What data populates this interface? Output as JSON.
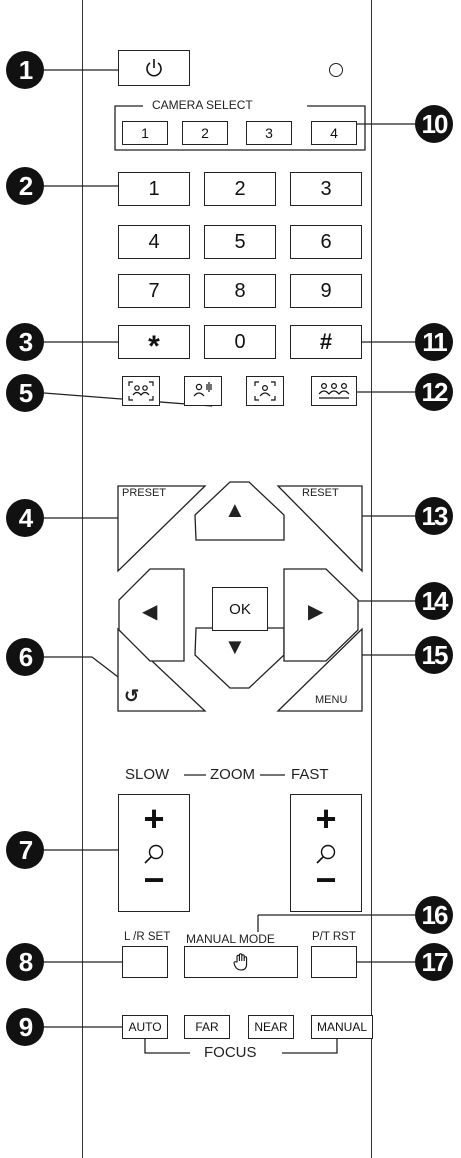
{
  "camera_select": {
    "label": "CAMERA SELECT",
    "buttons": [
      "1",
      "2",
      "3",
      "4"
    ]
  },
  "keypad": {
    "keys": [
      "1",
      "2",
      "3",
      "4",
      "5",
      "6",
      "7",
      "8",
      "9",
      "*",
      "0",
      "#"
    ]
  },
  "direction": {
    "preset": "PRESET",
    "reset": "RESET",
    "ok": "OK",
    "menu": "MENU",
    "up_glyph": "▲",
    "down_glyph": "▼",
    "left_glyph": "◀",
    "right_glyph": "▶",
    "back_glyph": "↺"
  },
  "zoom": {
    "slow": "SLOW",
    "zoom": "ZOOM",
    "fast": "FAST",
    "plus": "+",
    "minus": "−"
  },
  "settings": {
    "lr_set": "L /R SET",
    "manual_mode": "MANUAL MODE",
    "pt_rst": "P/T RST"
  },
  "focus": {
    "label": "FOCUS",
    "buttons": [
      "AUTO",
      "FAR",
      "NEAR",
      "MANUAL"
    ]
  },
  "callouts": [
    "1",
    "2",
    "3",
    "4",
    "5",
    "6",
    "7",
    "8",
    "9",
    "10",
    "11",
    "12",
    "13",
    "14",
    "15",
    "16",
    "17"
  ]
}
